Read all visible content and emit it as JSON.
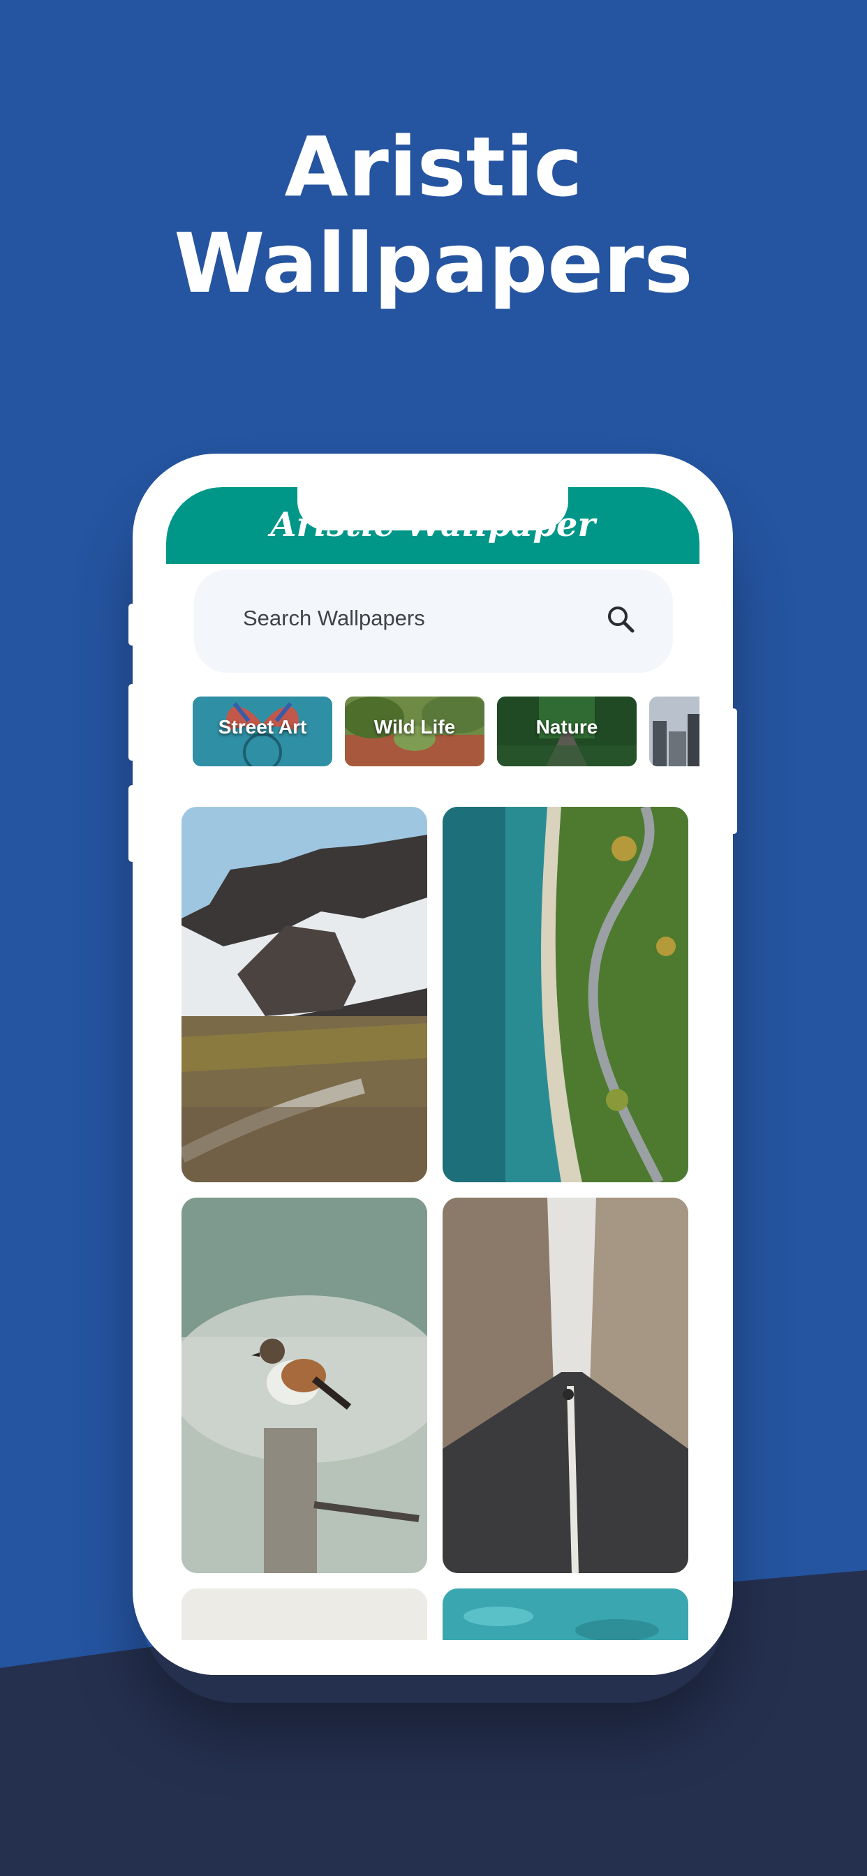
{
  "headline": {
    "line1": "Aristic",
    "line2": "Wallpapers"
  },
  "app": {
    "title": "Aristic Wallpaper",
    "search_placeholder": "Search Wallpapers"
  },
  "categories": [
    {
      "label": "Street Art"
    },
    {
      "label": "Wild Life"
    },
    {
      "label": "Nature"
    },
    {
      "label": ""
    }
  ],
  "colors": {
    "background": "#2554a0",
    "bottom_band": "#25304f",
    "app_bar": "#009688"
  },
  "icons": {
    "search": "search-icon"
  }
}
